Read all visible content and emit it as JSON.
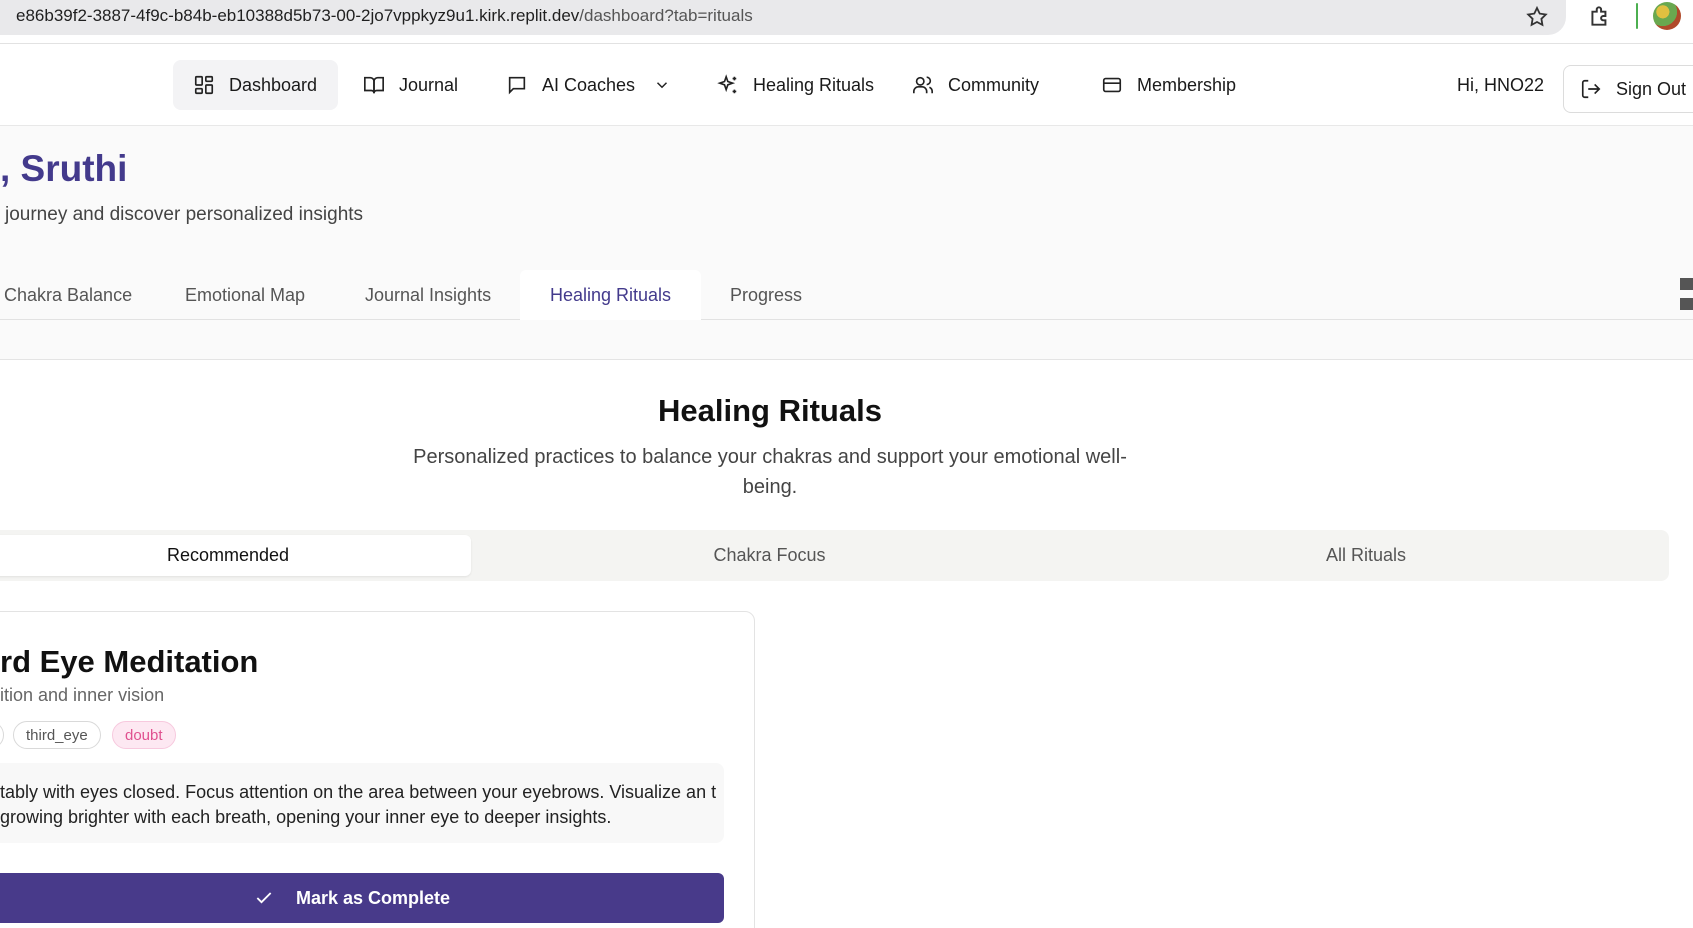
{
  "browser": {
    "url_host": "e86b39f2-3887-4f9c-b84b-eb10388d5b73-00-2jo7vppkyz9u1.kirk.replit.dev",
    "url_path": "/dashboard?tab=rituals"
  },
  "nav": {
    "items": [
      {
        "label": "Dashboard",
        "icon": "grid-icon"
      },
      {
        "label": "Journal",
        "icon": "book-icon"
      },
      {
        "label": "AI Coaches",
        "icon": "chat-icon"
      },
      {
        "label": "Healing Rituals",
        "icon": "sparkles-icon"
      },
      {
        "label": "Community",
        "icon": "users-icon"
      },
      {
        "label": "Membership",
        "icon": "card-icon"
      }
    ],
    "greeting": "Hi, HNO22",
    "sign_out": "Sign Out"
  },
  "header": {
    "title": ", Sruthi",
    "subtitle": "journey and discover personalized insights"
  },
  "dashboard_tabs": [
    "Chakra Balance",
    "Emotional Map",
    "Journal Insights",
    "Healing Rituals",
    "Progress"
  ],
  "dashboard_active_tab": "Healing Rituals",
  "rituals": {
    "title": "Healing Rituals",
    "description": "Personalized practices to balance your chakras and support your emotional well-being.",
    "sub_tabs": [
      "Recommended",
      "Chakra Focus",
      "All Rituals"
    ],
    "active_sub_tab": "Recommended",
    "card": {
      "title": "rd Eye Meditation",
      "subtitle": "ition and inner vision",
      "tags": [
        "third_eye",
        "doubt"
      ],
      "instructions": "tably with eyes closed. Focus attention on the area between your eyebrows. Visualize an t growing brighter with each breath, opening your inner eye to deeper insights.",
      "button": "Mark as Complete"
    }
  },
  "colors": {
    "brand": "#433a8c",
    "button": "#483a8a",
    "doubt_tag": "#e0508f"
  }
}
